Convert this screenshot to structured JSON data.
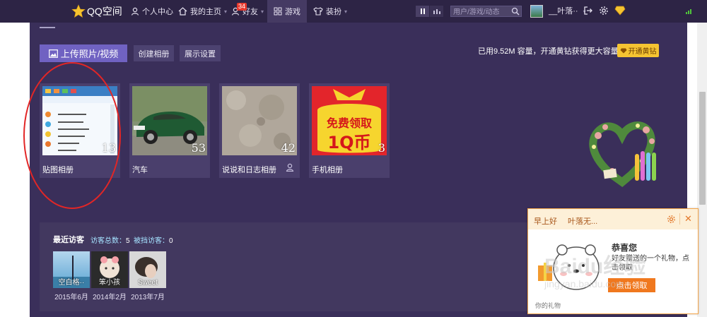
{
  "topbar": {
    "logo_text": "QQ空间",
    "nav": [
      {
        "label": "个人中心",
        "icon": "person-icon"
      },
      {
        "label": "我的主页",
        "icon": "home-icon",
        "caret": "▾"
      },
      {
        "label": "好友",
        "icon": "friends-icon",
        "badge": "34",
        "caret": "▾"
      },
      {
        "label": "游戏",
        "icon": "game-grid-icon",
        "active": true
      },
      {
        "label": "装扮",
        "icon": "shirt-icon",
        "caret": "▾"
      }
    ],
    "search_placeholder": "用户/游戏/动态",
    "username": "__叶落··",
    "user_caret": "▾",
    "accent_color": "#2d2445"
  },
  "main": {
    "upload_label": "上传照片/视频",
    "create_album_label": "创建相册",
    "display_settings_label": "展示设置",
    "storage_text": "已用9.52M 容量，开通黄钻获得更大容量",
    "vip_button_label": "开通黄钻"
  },
  "albums": [
    {
      "name": "贴图相册",
      "count": "13"
    },
    {
      "name": "汽车",
      "count": "53"
    },
    {
      "name": "说说和日志相册",
      "count": "42"
    },
    {
      "name": "手机相册",
      "count": "3"
    }
  ],
  "promo_image": {
    "line1": "免费领取",
    "line2": "1Q币"
  },
  "visitors": {
    "title": "最近访客",
    "total_label": "访客总数：",
    "total_value": "5",
    "visited_label": "被挡访客：",
    "visited_value": "0",
    "items": [
      {
        "name": "空白格··",
        "date": "2015年6月"
      },
      {
        "name": "笨小孩",
        "date": "2014年2月"
      },
      {
        "name": "Sweet",
        "date": "2013年7月"
      }
    ]
  },
  "popup": {
    "greeting": "早上好",
    "name": "叶落无...",
    "close": "✕",
    "congrats": "恭喜您",
    "message": "好友赠送的一个礼物，点击领取",
    "claim_label": "点击领取",
    "footer": "你的礼物"
  },
  "watermark": {
    "main": "Baidu经验",
    "sub": "jingyan.baidu.com"
  }
}
